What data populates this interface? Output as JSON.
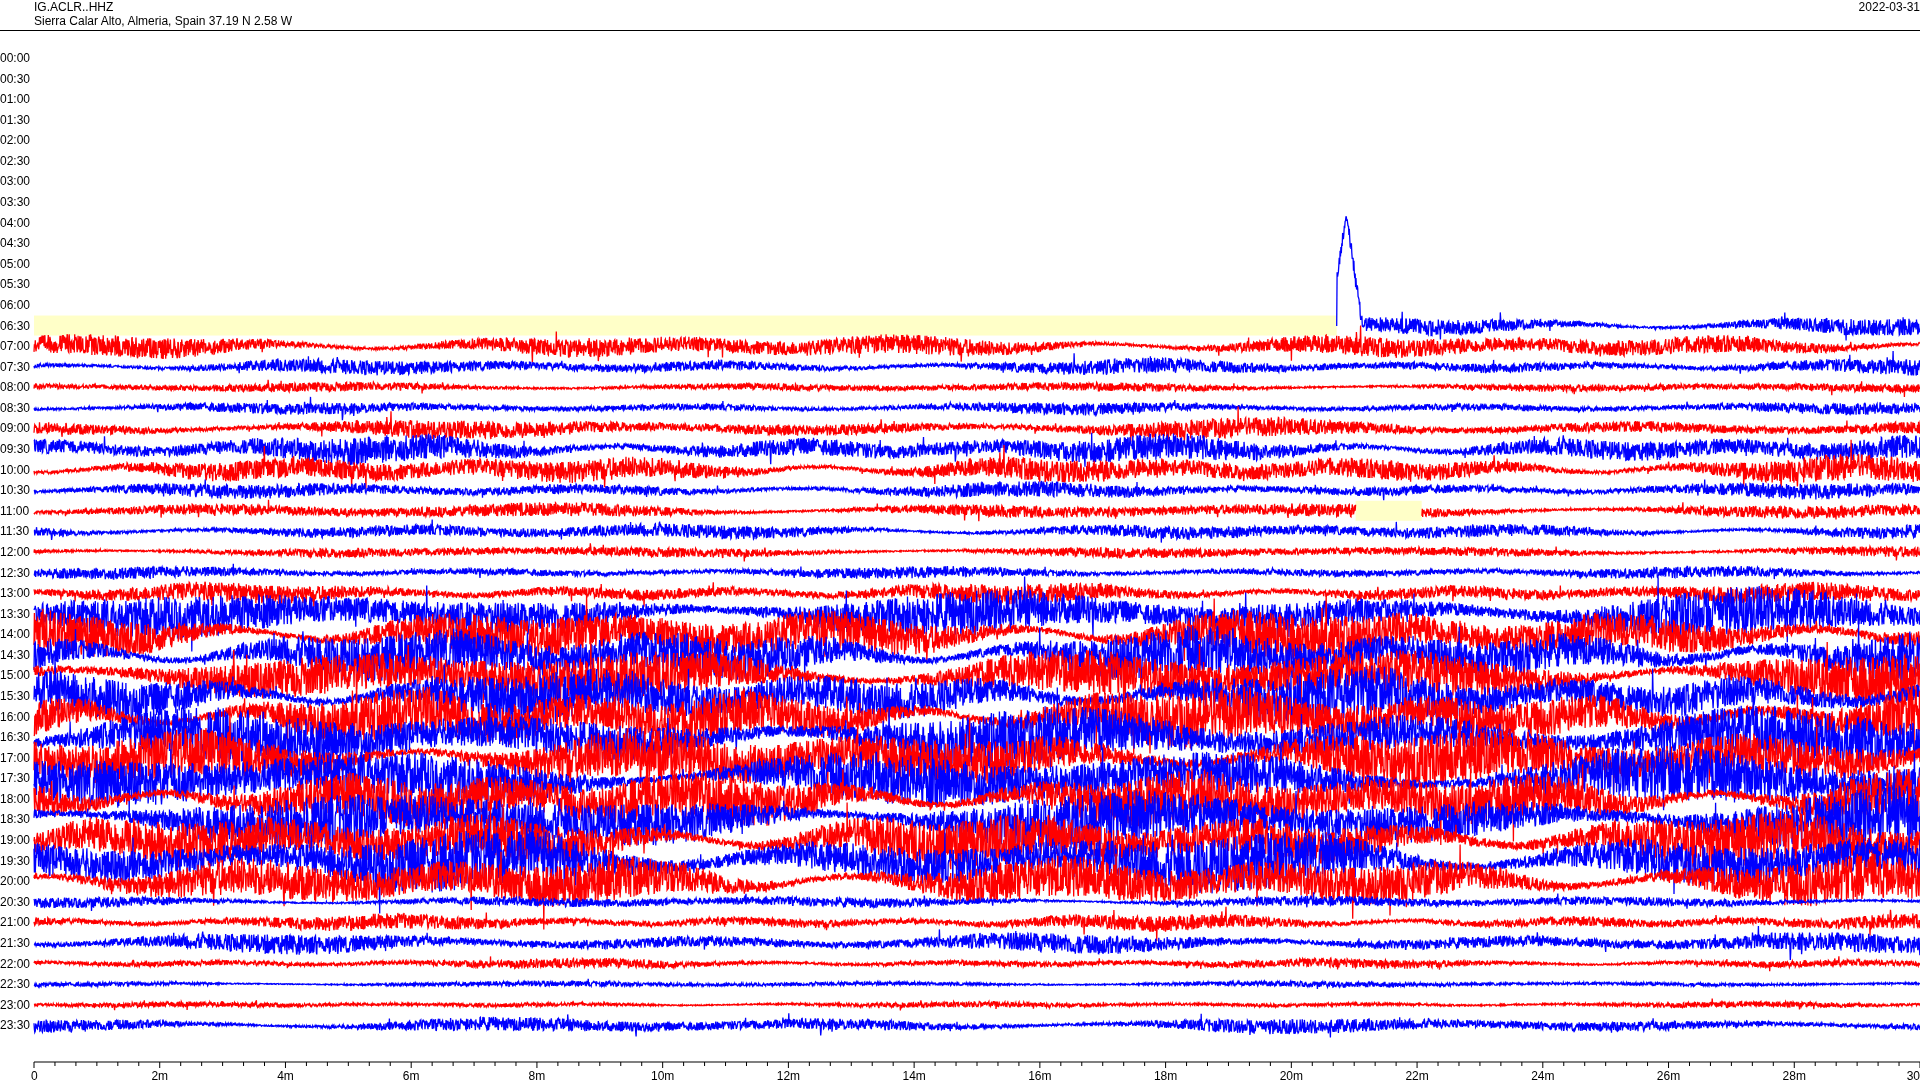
{
  "header": {
    "station": "IG.ACLR..HHZ",
    "location": "Sierra Calar Alto, Almeria, Spain  37.19 N 2.58 W",
    "date": "2022-03-31"
  },
  "rows": [
    {
      "label": "00:00"
    },
    {
      "label": "00:30"
    },
    {
      "label": "01:00"
    },
    {
      "label": "01:30"
    },
    {
      "label": "02:00"
    },
    {
      "label": "02:30"
    },
    {
      "label": "03:00"
    },
    {
      "label": "03:30"
    },
    {
      "label": "04:00"
    },
    {
      "label": "04:30"
    },
    {
      "label": "05:00"
    },
    {
      "label": "05:30"
    },
    {
      "label": "06:00"
    },
    {
      "label": "06:30",
      "color": "#0000ff",
      "gap": true
    },
    {
      "label": "07:00",
      "color": "#ff0000"
    },
    {
      "label": "07:30",
      "color": "#0000ff"
    },
    {
      "label": "08:00",
      "color": "#ff0000"
    },
    {
      "label": "08:30",
      "color": "#0000ff"
    },
    {
      "label": "09:00",
      "color": "#ff0000"
    },
    {
      "label": "09:30",
      "color": "#0000ff"
    },
    {
      "label": "10:00",
      "color": "#ff0000"
    },
    {
      "label": "10:30",
      "color": "#0000ff"
    },
    {
      "label": "11:00",
      "color": "#ff0000",
      "gap": true
    },
    {
      "label": "11:30",
      "color": "#0000ff"
    },
    {
      "label": "12:00",
      "color": "#ff0000"
    },
    {
      "label": "12:30",
      "color": "#0000ff"
    },
    {
      "label": "13:00",
      "color": "#ff0000"
    },
    {
      "label": "13:30",
      "color": "#0000ff"
    },
    {
      "label": "14:00",
      "color": "#ff0000"
    },
    {
      "label": "14:30",
      "color": "#0000ff"
    },
    {
      "label": "15:00",
      "color": "#ff0000"
    },
    {
      "label": "15:30",
      "color": "#0000ff"
    },
    {
      "label": "16:00",
      "color": "#ff0000"
    },
    {
      "label": "16:30",
      "color": "#0000ff"
    },
    {
      "label": "17:00",
      "color": "#ff0000"
    },
    {
      "label": "17:30",
      "color": "#0000ff"
    },
    {
      "label": "18:00",
      "color": "#ff0000"
    },
    {
      "label": "18:30",
      "color": "#0000ff"
    },
    {
      "label": "19:00",
      "color": "#ff0000"
    },
    {
      "label": "19:30",
      "color": "#0000ff"
    },
    {
      "label": "20:00",
      "color": "#ff0000"
    },
    {
      "label": "20:30",
      "color": "#0000ff"
    },
    {
      "label": "21:00",
      "color": "#ff0000"
    },
    {
      "label": "21:30",
      "color": "#0000ff"
    },
    {
      "label": "22:00",
      "color": "#ff0000"
    },
    {
      "label": "22:30",
      "color": "#0000ff"
    },
    {
      "label": "23:00",
      "color": "#ff0000"
    },
    {
      "label": "23:30",
      "color": "#0000ff"
    }
  ],
  "x_axis": {
    "ticks": [
      "0",
      "2m",
      "4m",
      "6m",
      "8m",
      "10m",
      "12m",
      "14m",
      "16m",
      "18m",
      "20m",
      "22m",
      "24m",
      "26m",
      "28m",
      "30"
    ]
  }
}
